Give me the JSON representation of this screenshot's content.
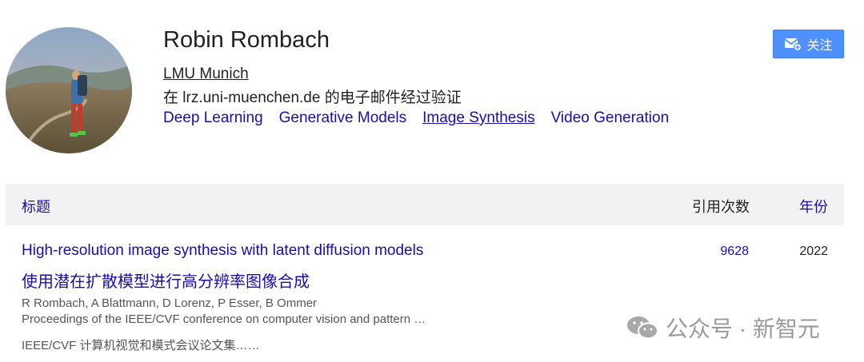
{
  "profile": {
    "name": "Robin Rombach",
    "affiliation": "LMU Munich",
    "verified_email": "在 lrz.uni-muenchen.de 的电子邮件经过验证",
    "interests": [
      "Deep Learning",
      "Generative Models",
      "Image Synthesis",
      "Video Generation"
    ],
    "follow_label": "关注"
  },
  "table": {
    "headers": {
      "title": "标题",
      "citations": "引用次数",
      "year": "年份"
    },
    "rows": [
      {
        "title": "High-resolution image synthesis with latent diffusion models",
        "title_translation": "使用潜在扩散模型进行高分辨率图像合成",
        "authors": "R Rombach, A Blattmann, D Lorenz, P Esser, B Ommer",
        "venue": "Proceedings of the IEEE/CVF conference on computer vision and pattern …",
        "venue_translation": "IEEE/CVF 计算机视觉和模式会议论文集……",
        "citations": "9628",
        "year": "2022"
      }
    ]
  },
  "watermark": {
    "text": "公众号 · 新智元",
    "icon": "wechat-icon"
  },
  "colors": {
    "link": "#1a0dab",
    "button": "#4d90fe",
    "header_bg": "#f2f2f2"
  }
}
